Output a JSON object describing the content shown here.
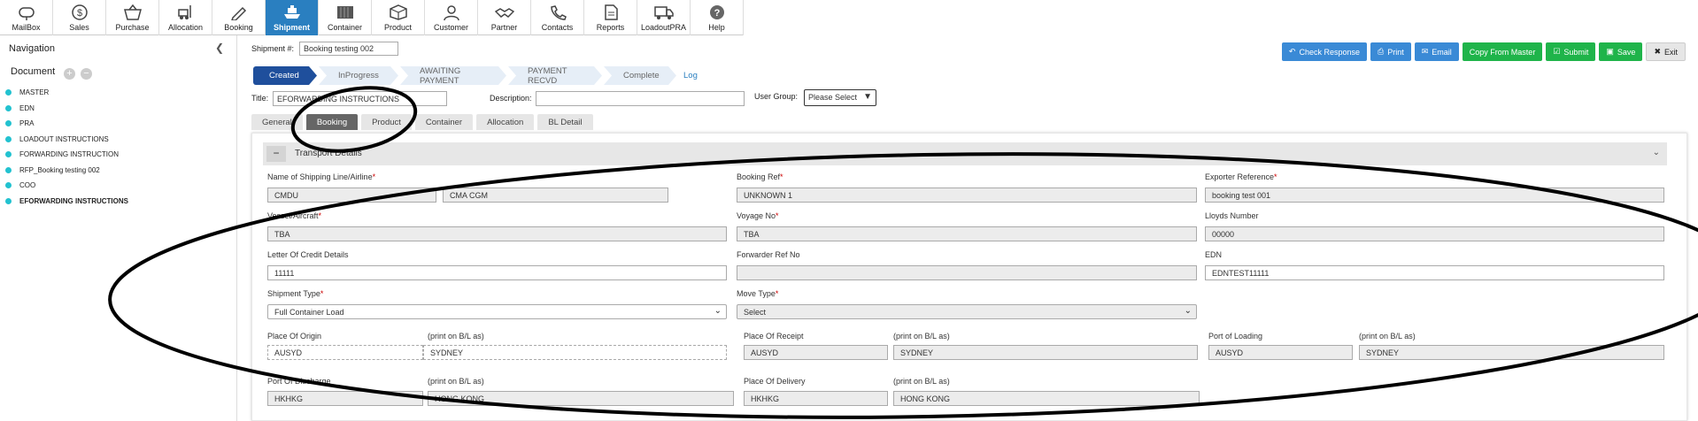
{
  "topnav": [
    {
      "label": "MailBox",
      "icon": "mailbox-icon"
    },
    {
      "label": "Sales",
      "icon": "dollar-icon"
    },
    {
      "label": "Purchase",
      "icon": "basket-icon"
    },
    {
      "label": "Allocation",
      "icon": "forklift-icon"
    },
    {
      "label": "Booking",
      "icon": "pen-icon"
    },
    {
      "label": "Shipment",
      "icon": "ship-icon"
    },
    {
      "label": "Container",
      "icon": "container-icon"
    },
    {
      "label": "Product",
      "icon": "box-icon"
    },
    {
      "label": "Customer",
      "icon": "person-icon"
    },
    {
      "label": "Partner",
      "icon": "handshake-icon"
    },
    {
      "label": "Contacts",
      "icon": "phone-icon"
    },
    {
      "label": "Reports",
      "icon": "report-icon"
    },
    {
      "label": "LoadoutPRA",
      "icon": "truck-icon"
    },
    {
      "label": "Help",
      "icon": "help-icon"
    }
  ],
  "sidebar": {
    "heading": "Navigation",
    "document_label": "Document",
    "items": [
      {
        "label": "MASTER"
      },
      {
        "label": "EDN"
      },
      {
        "label": "PRA"
      },
      {
        "label": "LOADOUT INSTRUCTIONS"
      },
      {
        "label": "FORWARDING INSTRUCTION"
      },
      {
        "label": "RFP_Booking testing 002"
      },
      {
        "label": "COO"
      },
      {
        "label": "EFORWARDING INSTRUCTIONS"
      }
    ]
  },
  "header": {
    "shipment_label": "Shipment #:",
    "shipment_value": "Booking testing 002",
    "title_label": "Title:",
    "title_value": "EFORWARDING INSTRUCTIONS",
    "description_label": "Description:",
    "description_value": "",
    "user_group_label": "User Group:",
    "user_group_value": "Please Select"
  },
  "actions": {
    "check_response": "Check Response",
    "print": "Print",
    "email": "Email",
    "copy_from_master": "Copy From Master",
    "submit": "Submit",
    "save": "Save",
    "exit": "Exit"
  },
  "progress": {
    "steps": [
      "Created",
      "InProgress",
      "AWAITING PAYMENT",
      "PAYMENT RECVD",
      "Complete"
    ],
    "log": "Log"
  },
  "tabs": [
    "General",
    "Booking",
    "Product",
    "Container",
    "Allocation",
    "BL Detail"
  ],
  "section": {
    "title": "Transport Details"
  },
  "fields": {
    "shipping_line_label": "Name of Shipping Line/Airline",
    "shipping_line_code": "CMDU",
    "shipping_line_name": "CMA CGM",
    "booking_ref_label": "Booking Ref",
    "booking_ref_value": "UNKNOWN 1",
    "exporter_ref_label": "Exporter Reference",
    "exporter_ref_value": "booking test 001",
    "vessel_label": "Vessel/Aircraft",
    "vessel_value": "TBA",
    "voyage_label": "Voyage No",
    "voyage_value": "TBA",
    "lloyds_label": "Lloyds Number",
    "lloyds_value": "00000",
    "loc_label": "Letter Of Credit Details",
    "loc_value": "11111",
    "fwd_ref_label": "Forwarder Ref No",
    "fwd_ref_value": "",
    "edn_label": "EDN",
    "edn_value": "EDNTEST11111",
    "shipment_type_label": "Shipment Type",
    "shipment_type_value": "Full Container Load",
    "move_type_label": "Move Type",
    "move_type_value": "Select",
    "place_origin_label": "Place Of Origin",
    "place_origin_code": "AUSYD",
    "place_origin_print": "SYDNEY",
    "print_on_bl_label": "(print on B/L as)",
    "place_receipt_label": "Place Of Receipt",
    "place_receipt_code": "AUSYD",
    "place_receipt_print": "SYDNEY",
    "port_loading_label": "Port of Loading",
    "port_loading_code": "AUSYD",
    "port_loading_print": "SYDNEY",
    "port_discharge_label": "Port Of Discharge",
    "port_discharge_code": "HKHKG",
    "port_discharge_print": "HONG KONG",
    "place_delivery_label": "Place Of Delivery",
    "place_delivery_code": "HKHKG",
    "place_delivery_print": "HONG KONG"
  },
  "colors": {
    "active_nav": "#2a7fc0",
    "active_step": "#1f4f9c",
    "button_blue": "#3a8ad6",
    "button_green": "#1fb44a",
    "sidebar_dot": "#22c2d0"
  }
}
